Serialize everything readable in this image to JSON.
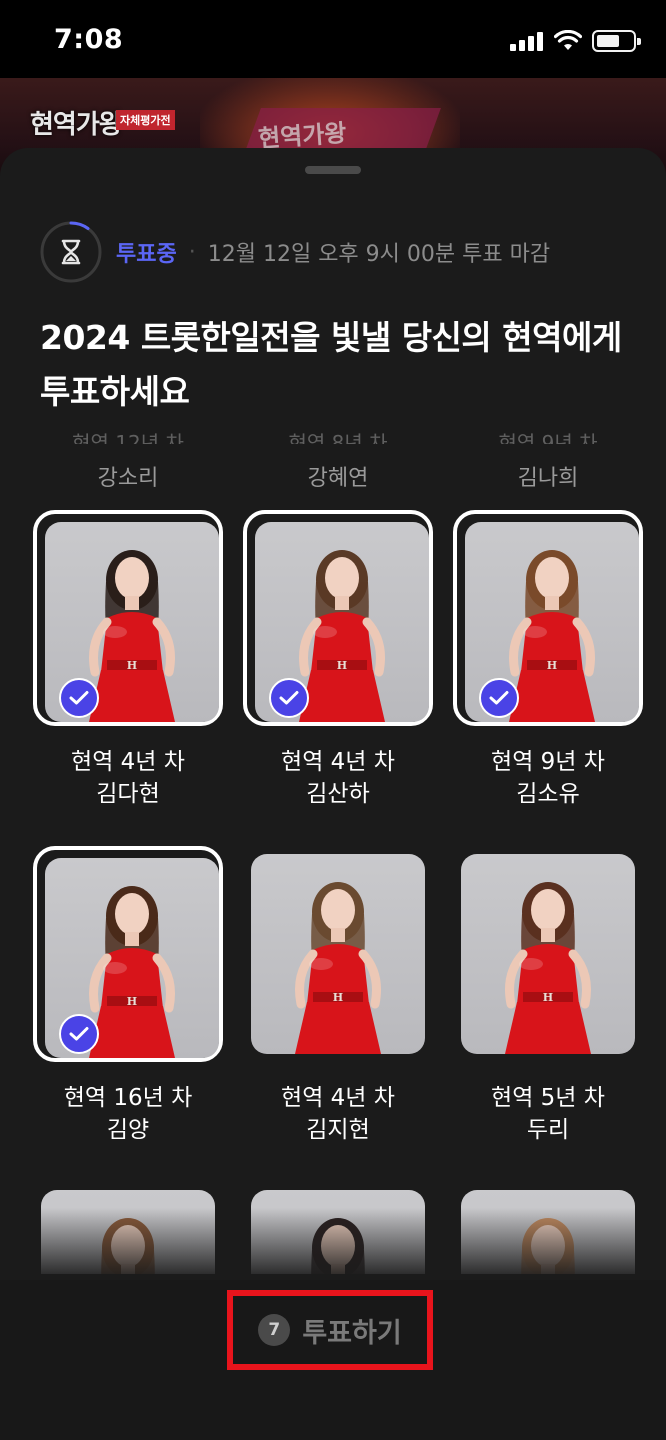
{
  "status_bar": {
    "time": "7:08"
  },
  "background": {
    "logo_text": "현역가왕",
    "logo_sub": "자체평가전",
    "right_text": "현역가왕"
  },
  "voting": {
    "status_label": "투표중",
    "deadline": "12월 12일 오후 9시 00분 투표 마감",
    "title": "2024 트롯한일전을 빛낼 당신의 현역에게 투표하세요"
  },
  "faded_row": [
    {
      "career": "현역 12년 차",
      "name": "강소리"
    },
    {
      "career": "현역 8년 차",
      "name": "강혜연"
    },
    {
      "career": "현역 9년 차",
      "name": "김나희"
    }
  ],
  "candidates": [
    {
      "career": "현역 4년 차",
      "name": "김다현",
      "selected": true
    },
    {
      "career": "현역 4년 차",
      "name": "김산하",
      "selected": true
    },
    {
      "career": "현역 9년 차",
      "name": "김소유",
      "selected": true
    },
    {
      "career": "현역 16년 차",
      "name": "김양",
      "selected": true
    },
    {
      "career": "현역 4년 차",
      "name": "김지현",
      "selected": false
    },
    {
      "career": "현역 5년 차",
      "name": "두리",
      "selected": false
    },
    {
      "career": "",
      "name": "",
      "selected": false
    },
    {
      "career": "",
      "name": "",
      "selected": false
    },
    {
      "career": "",
      "name": "",
      "selected": false
    }
  ],
  "bottom": {
    "vote_count": "7",
    "vote_label": "투표하기"
  },
  "colors": {
    "accent": "#5b66f5",
    "check": "#4a43e6",
    "highlight": "#e8141c",
    "outfit": "#d8141a"
  },
  "icons": {
    "timer": "hourglass-icon",
    "check": "check-icon"
  }
}
